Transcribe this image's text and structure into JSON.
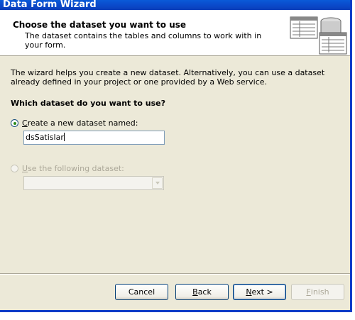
{
  "window": {
    "title": "Data Form Wizard"
  },
  "header": {
    "title": "Choose the dataset you want to use",
    "subtitle": "The dataset contains the tables and columns to work with in your form."
  },
  "body": {
    "intro": "The wizard helps you create a new dataset. Alternatively, you can use a dataset already defined in your project or one provided by a Web service.",
    "question": "Which dataset do you want to use?",
    "option_new": {
      "label": "Create a new dataset named:",
      "selected": true,
      "value": "dsSatislar"
    },
    "option_existing": {
      "label": "Use the following dataset:",
      "selected": false,
      "enabled": false,
      "value": ""
    }
  },
  "buttons": {
    "cancel": "Cancel",
    "back": "Back",
    "next": "Next >",
    "finish": "Finish"
  },
  "colors": {
    "titlebar": "#0a48c8",
    "dialog_bg": "#ece9d8",
    "accent_border": "#003c74"
  }
}
